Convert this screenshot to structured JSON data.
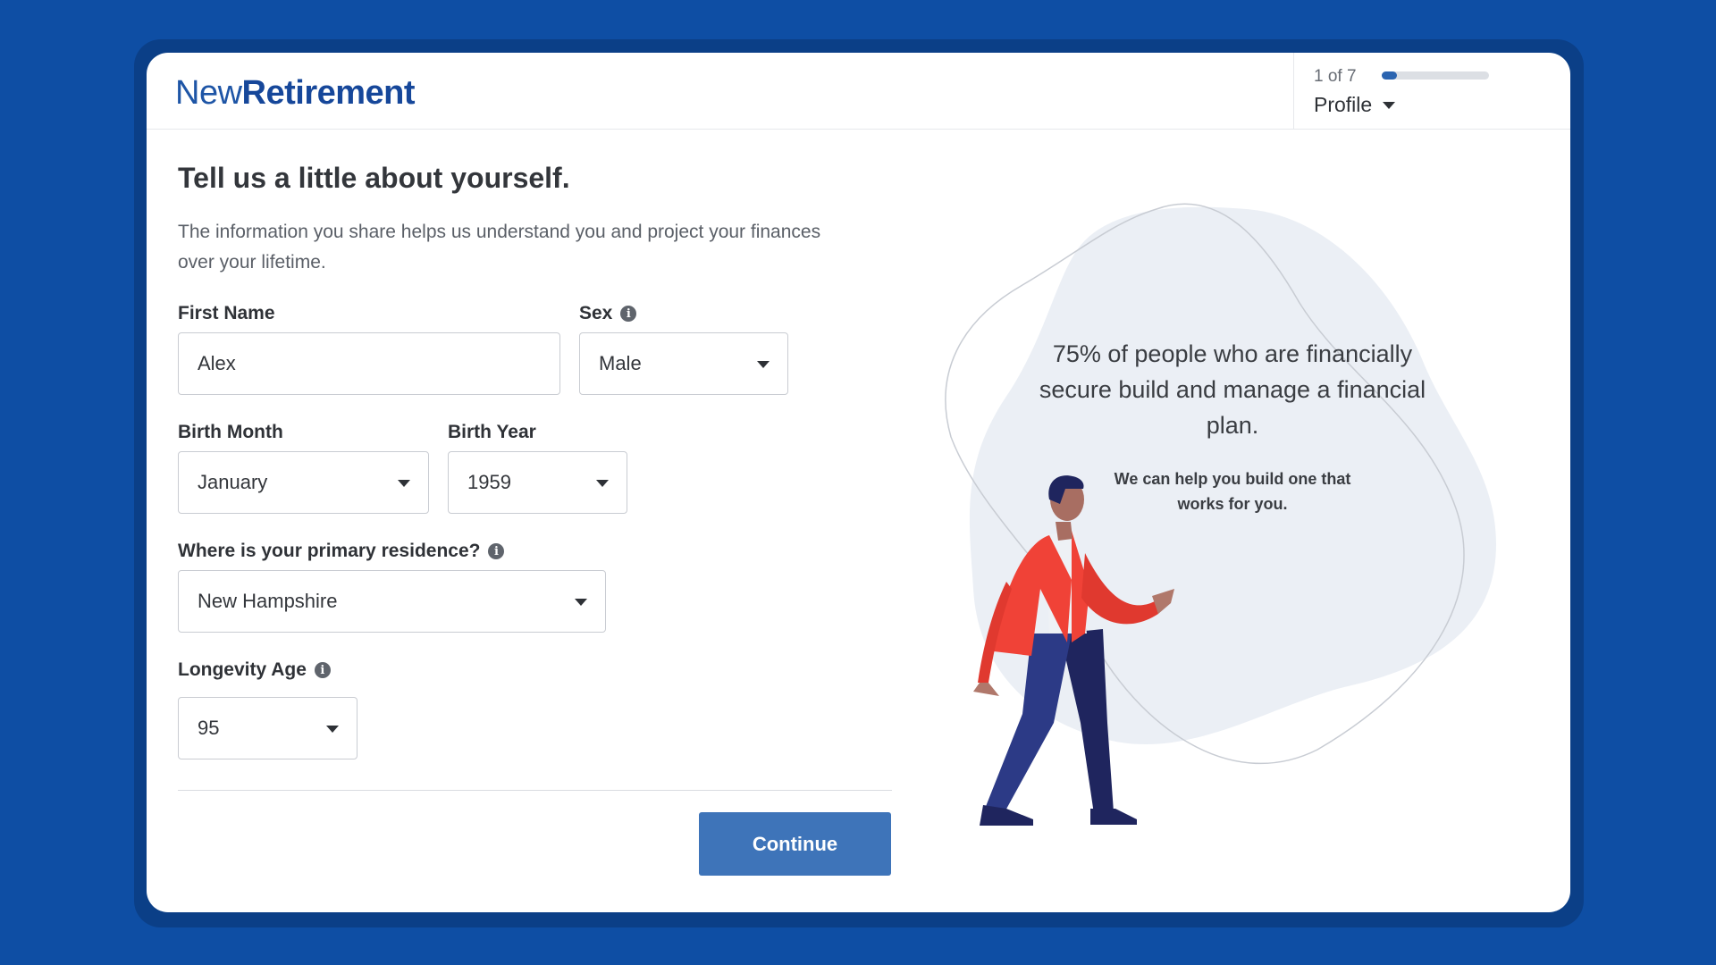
{
  "brand": {
    "part1": "New",
    "part2": "Retirement"
  },
  "progress": {
    "step_text": "1 of 7",
    "fraction": 0.14,
    "section": "Profile"
  },
  "form": {
    "title": "Tell us a little about yourself.",
    "subtitle": "The information you share helps us understand you and project your finances over your lifetime.",
    "first_name": {
      "label": "First Name",
      "value": "Alex"
    },
    "sex": {
      "label": "Sex",
      "value": "Male"
    },
    "birth_month": {
      "label": "Birth Month",
      "value": "January"
    },
    "birth_year": {
      "label": "Birth Year",
      "value": "1959"
    },
    "residence": {
      "label": "Where is your primary residence?",
      "value": "New Hampshire"
    },
    "longevity": {
      "label": "Longevity Age",
      "value": "95"
    },
    "continue_label": "Continue"
  },
  "aside": {
    "quote": "75% of people who are financially secure build and manage a financial plan.",
    "subtext": "We can help you build one that works for you."
  },
  "colors": {
    "page_bg": "#0e4ea4",
    "accent": "#3e74b9",
    "jacket": "#f04237",
    "pants_front": "#2c3a86",
    "pants_back": "#1f255e",
    "blob": "#ebeff5"
  },
  "icons": {
    "info": "info-icon",
    "dropdown": "chevron-down-icon"
  }
}
